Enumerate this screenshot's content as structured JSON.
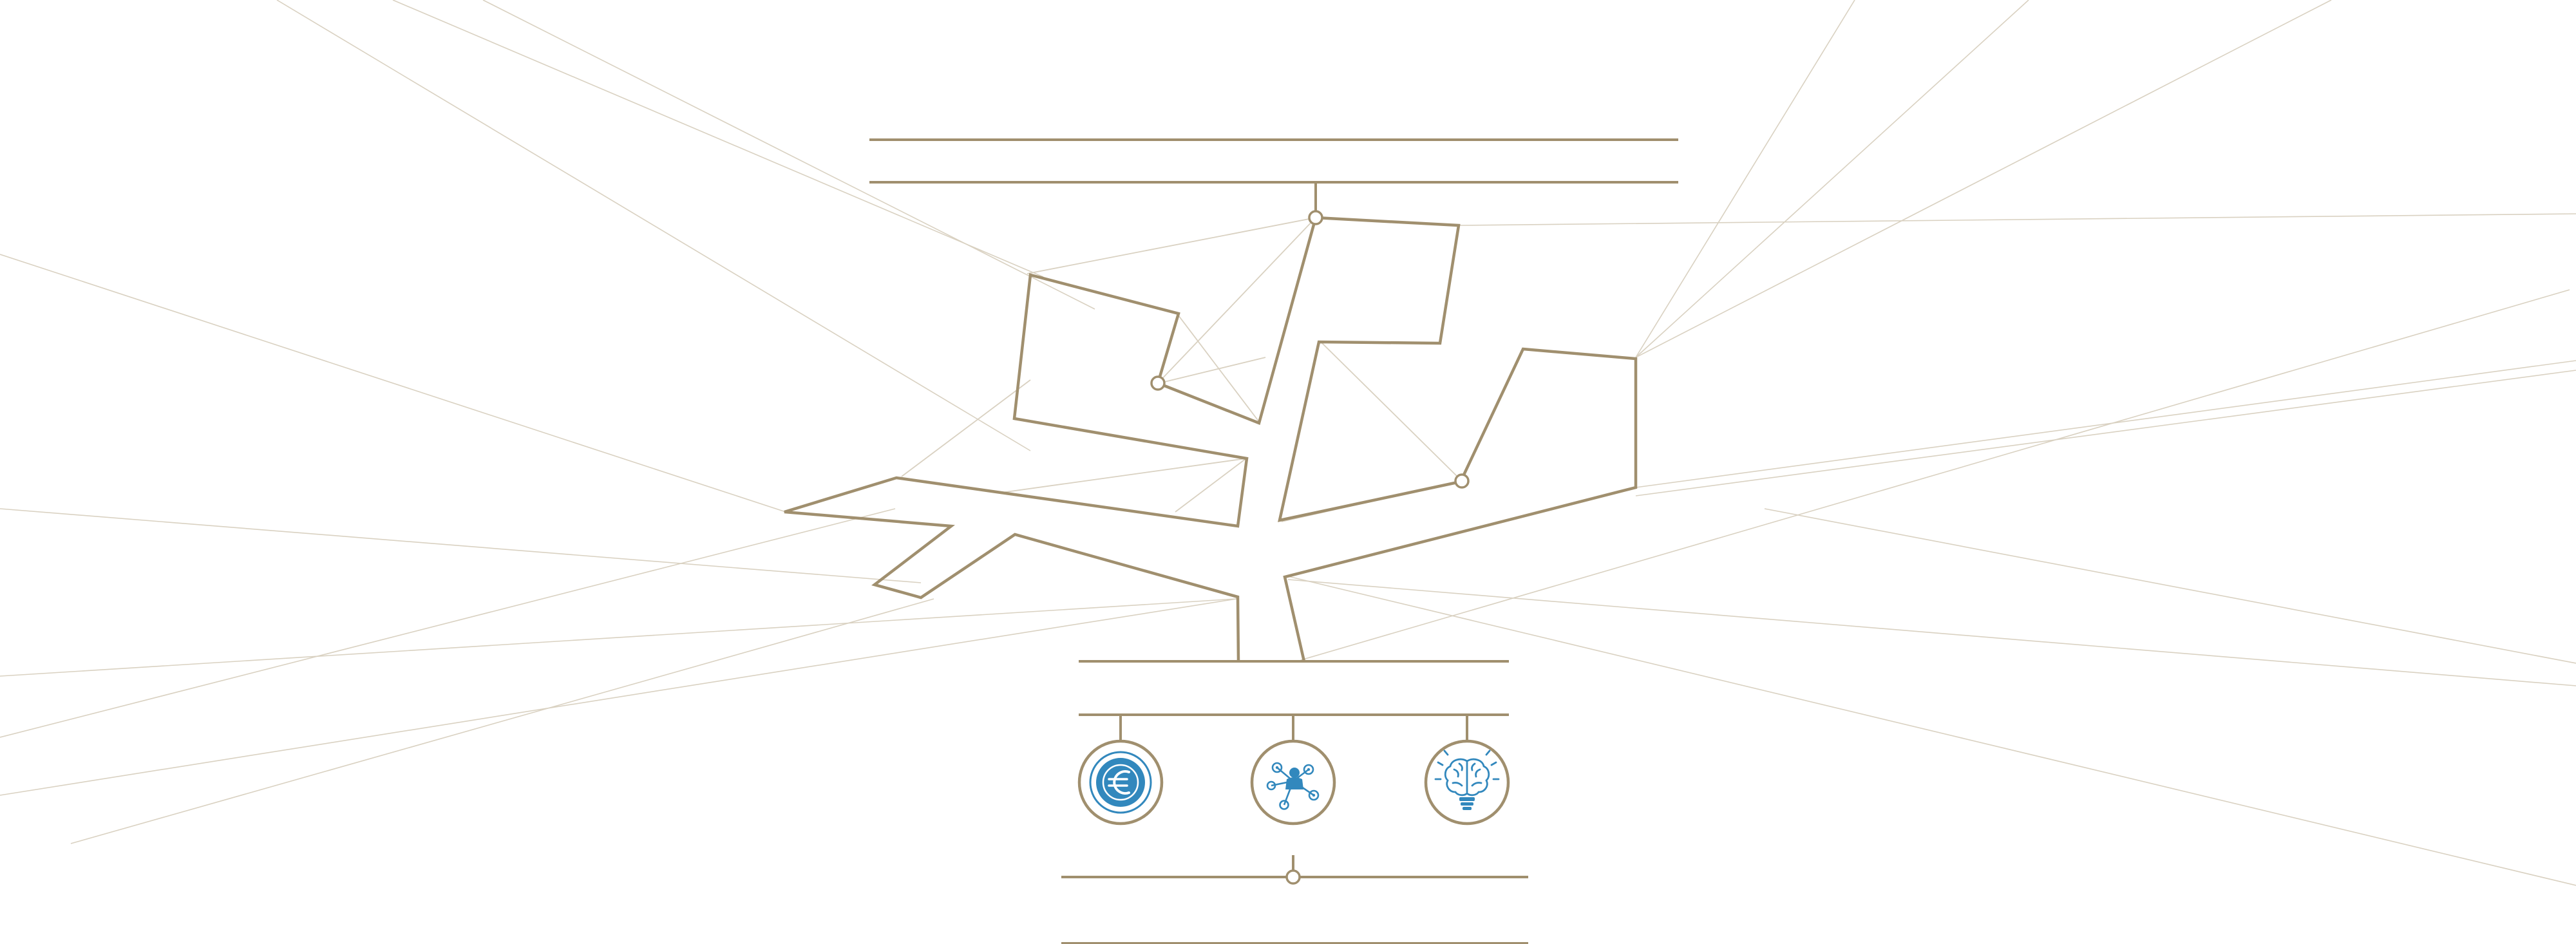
{
  "colors": {
    "line": "#a08f6e",
    "line_light": "#d9d1c1",
    "icon": "#3288bd",
    "background": "#ffffff"
  },
  "icons": [
    {
      "name": "euro-icon"
    },
    {
      "name": "network-person-icon"
    },
    {
      "name": "brain-lightbulb-icon"
    }
  ]
}
